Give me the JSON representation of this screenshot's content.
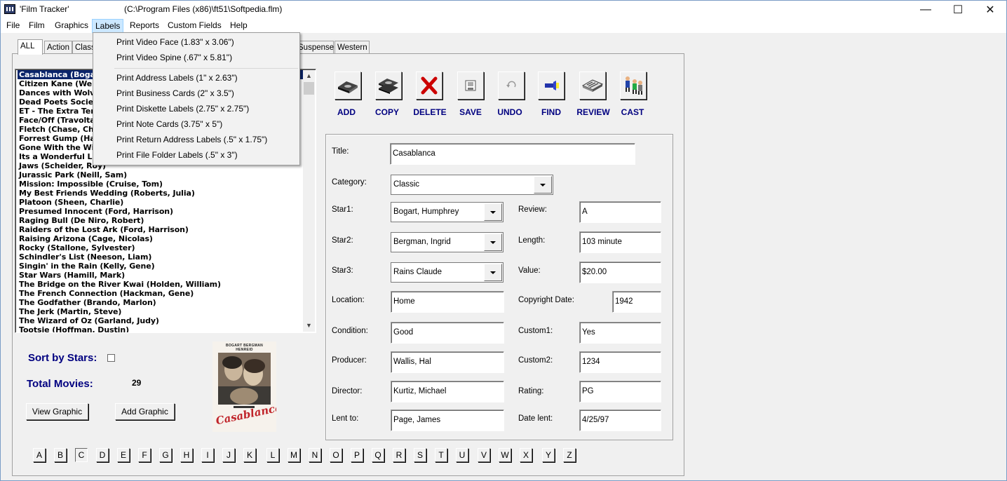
{
  "window": {
    "app_title": "'Film Tracker'",
    "path": "(C:\\Program Files (x86)\\ft51\\Softpedia.flm)",
    "minimize": "—",
    "maximize": "☐",
    "close": "✕"
  },
  "menubar": [
    "File",
    "Film",
    "Graphics",
    "Labels",
    "Reports",
    "Custom Fields",
    "Help"
  ],
  "tabs": [
    "ALL",
    "Action",
    "Class",
    "Suspense",
    "Western"
  ],
  "labels_menu": [
    "Print Video Face (1.83\" x 3.06\")",
    "Print Video Spine (.67\" x 5.81\")",
    "Print Address Labels (1\" x 2.63\")",
    "Print Business Cards (2\" x 3.5\")",
    "Print Diskette Labels (2.75\" x 2.75\")",
    "Print Note Cards (3.75\" x 5\")",
    "Print Return Address Labels (.5\" x 1.75\")",
    "Print File Folder Labels (.5\" x 3\")"
  ],
  "movies": [
    "Casablanca (Bogart, Humphrey)",
    "Citizen Kane (Welles, Orson)",
    "Dances with Wolves (Costner, Kevin)",
    "Dead Poets Society (Williams, Robin)",
    "ET - The Extra Terrestrial (Thomas, Henry)",
    "Face/Off (Travolta, John)",
    "Fletch (Chase, Chevy)",
    "Forrest Gump (Hanks, Tom)",
    "Gone With the Wind (Gable, Clark)",
    "Its a Wonderful Life (Stewart, James)",
    "Jaws (Scheider, Roy)",
    "Jurassic Park (Neill, Sam)",
    "Mission: Impossible (Cruise, Tom)",
    "My Best Friends Wedding (Roberts, Julia)",
    "Platoon (Sheen, Charlie)",
    "Presumed Innocent (Ford, Harrison)",
    "Raging Bull (De Niro, Robert)",
    "Raiders of the Lost Ark (Ford, Harrison)",
    "Raising Arizona (Cage, Nicolas)",
    "Rocky (Stallone, Sylvester)",
    "Schindler's List (Neeson, Liam)",
    "Singin' in the Rain (Kelly, Gene)",
    "Star Wars (Hamill, Mark)",
    "The Bridge on the River Kwai (Holden, William)",
    "The French Connection (Hackman, Gene)",
    "The Godfather (Brando, Marlon)",
    "The Jerk (Martin, Steve)",
    "The Wizard of Oz (Garland, Judy)",
    "Tootsie (Hoffman, Dustin)"
  ],
  "toolbar": [
    {
      "label": "ADD",
      "icon": "tape-icon"
    },
    {
      "label": "COPY",
      "icon": "copy-tape-icon"
    },
    {
      "label": "DELETE",
      "icon": "red-x-icon"
    },
    {
      "label": "SAVE",
      "icon": "floppy-icon"
    },
    {
      "label": "UNDO",
      "icon": "undo-icon"
    },
    {
      "label": "FIND",
      "icon": "flashlight-icon"
    },
    {
      "label": "REVIEW",
      "icon": "newspaper-icon"
    },
    {
      "label": "CAST",
      "icon": "people-icon"
    }
  ],
  "form": {
    "title_label": "Title:",
    "title": "Casablanca",
    "category_label": "Category:",
    "category": "Classic",
    "star1_label": "Star1:",
    "star1": "Bogart, Humphrey",
    "star2_label": "Star2:",
    "star2": "Bergman, Ingrid",
    "star3_label": "Star3:",
    "star3": "Rains Claude",
    "location_label": "Location:",
    "location": "Home",
    "condition_label": "Condition:",
    "condition": "Good",
    "producer_label": "Producer:",
    "producer": "Wallis, Hal",
    "director_label": "Director:",
    "director": "Kurtiz, Michael",
    "lent_to_label": "Lent to:",
    "lent_to": "Page, James",
    "review_label": "Review:",
    "review": "A",
    "length_label": "Length:",
    "length": "103 minute",
    "value_label": "Value:",
    "value": "$20.00",
    "copyright_label": "Copyright Date:",
    "copyright": "1942",
    "custom1_label": "Custom1:",
    "custom1": "Yes",
    "custom2_label": "Custom2:",
    "custom2": "1234",
    "rating_label": "Rating:",
    "rating": "PG",
    "date_lent_label": "Date lent:",
    "date_lent": "4/25/97"
  },
  "bottom": {
    "sort_label": "Sort by Stars:",
    "total_label": "Total Movies:",
    "total": "29",
    "view_graphic": "View Graphic",
    "add_graphic": "Add Graphic",
    "poster_title": "Casablanca",
    "poster_stars": "BOGART BERGMAN HENREID"
  },
  "alphabet": [
    "A",
    "B",
    "C",
    "D",
    "E",
    "F",
    "G",
    "H",
    "I",
    "J",
    "K",
    "L",
    "M",
    "N",
    "O",
    "P",
    "Q",
    "R",
    "S",
    "T",
    "U",
    "V",
    "W",
    "X",
    "Y",
    "Z"
  ]
}
